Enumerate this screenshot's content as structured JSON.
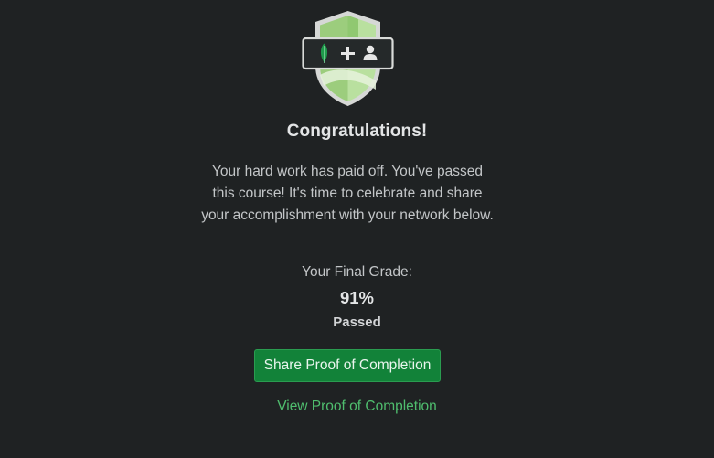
{
  "badge": {
    "icons": [
      "leaf-icon",
      "plus-icon",
      "person-icon"
    ],
    "colors": {
      "shield_outer": "#d9d9d9",
      "shield_green": "#9ad17b",
      "shield_light": "#c8e6b4",
      "panel_bg": "#262a2b",
      "leaf": "#1e9a4a"
    }
  },
  "congrats": {
    "title": "Congratulations!",
    "message": "Your hard work has paid off. You've passed this course! It's time to celebrate and share your accomplishment with your network below."
  },
  "grade": {
    "label": "Your Final Grade:",
    "value": "91%",
    "status": "Passed"
  },
  "actions": {
    "share_label": "Share Proof of Completion",
    "view_label": "View Proof of Completion"
  },
  "colors": {
    "background": "#1f2223",
    "accent": "#128239",
    "link": "#4fbd6e"
  }
}
